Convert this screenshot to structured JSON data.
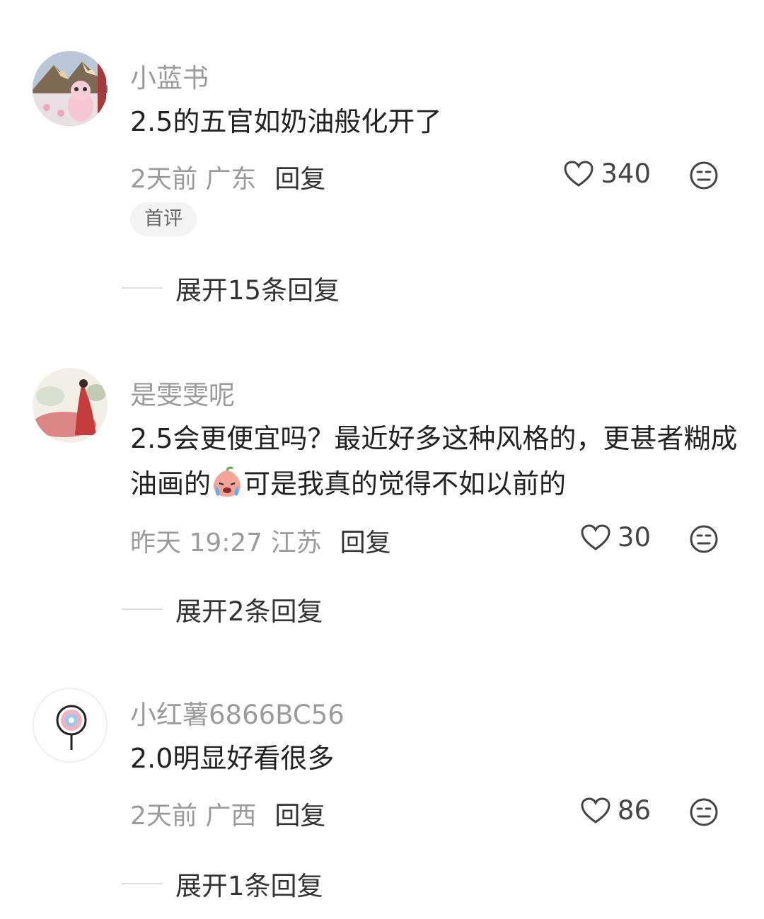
{
  "comments": [
    {
      "username": "小蓝书",
      "text": "2.5的五官如奶油般化开了",
      "time_location": "2天前 广东",
      "reply_label": "回复",
      "likes": "340",
      "badge": "首评",
      "expand_label": "展开15条回复"
    },
    {
      "username": "是雯雯呢",
      "text_part1": "2.5会更便宜吗？最近好多这种风格的，更甚者糊成油画的",
      "text_part2": "可是我真的觉得不如以前的",
      "time_location": "昨天 19:27 江苏",
      "reply_label": "回复",
      "likes": "30",
      "expand_label": "展开2条回复"
    },
    {
      "username": "小红薯6866BC56",
      "text": "2.0明显好看很多",
      "time_location": "2天前 广西",
      "reply_label": "回复",
      "likes": "86",
      "expand_label": "展开1条回复"
    }
  ],
  "icons": {
    "like": "heart-outline-icon",
    "dislike": "neutral-face-icon",
    "emoji": "crying-peach-emoji"
  },
  "colors": {
    "username": "#9b9b9b",
    "text": "#222222",
    "meta": "#9b9b9b",
    "badge_bg": "#f3f3f3"
  }
}
